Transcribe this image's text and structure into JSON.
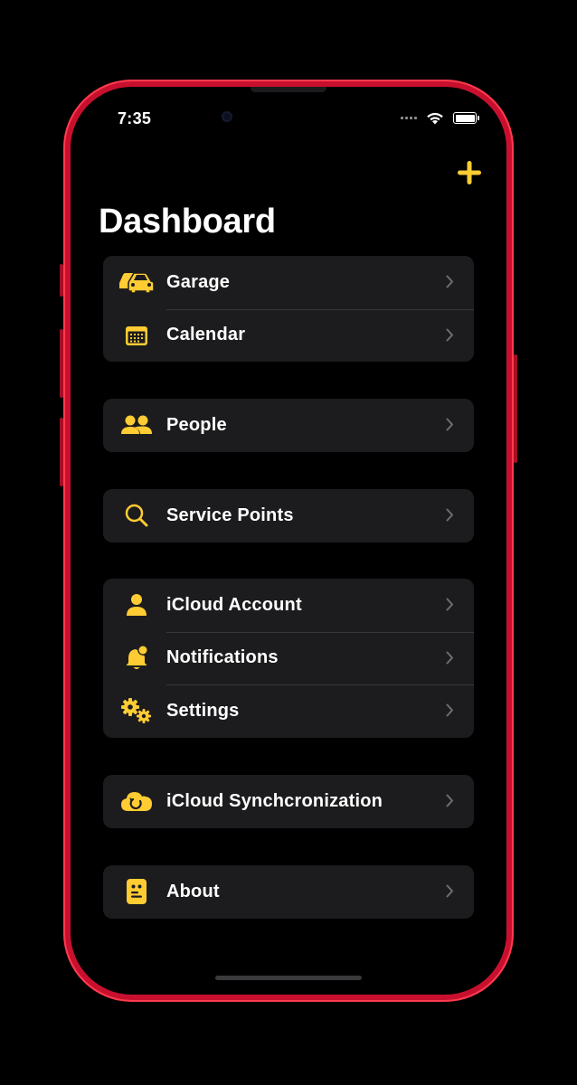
{
  "status": {
    "time": "7:35"
  },
  "header": {
    "title": "Dashboard",
    "add_icon": "plus-icon"
  },
  "colors": {
    "accent": "#ffcc33",
    "frame": "#c8102e",
    "row_bg": "#1c1c1e",
    "chevron": "#6e6e73"
  },
  "groups": [
    {
      "items": [
        {
          "label": "Garage",
          "icon": "cars-icon"
        },
        {
          "label": "Calendar",
          "icon": "calendar-icon"
        }
      ]
    },
    {
      "items": [
        {
          "label": "People",
          "icon": "people-icon"
        }
      ]
    },
    {
      "items": [
        {
          "label": "Service Points",
          "icon": "search-icon"
        }
      ]
    },
    {
      "items": [
        {
          "label": "iCloud Account",
          "icon": "person-icon"
        },
        {
          "label": "Notifications",
          "icon": "bell-icon"
        },
        {
          "label": "Settings",
          "icon": "gears-icon"
        }
      ]
    },
    {
      "items": [
        {
          "label": "iCloud Synchcronization",
          "icon": "cloud-sync-icon"
        }
      ]
    },
    {
      "items": [
        {
          "label": "About",
          "icon": "info-card-icon"
        }
      ]
    }
  ]
}
